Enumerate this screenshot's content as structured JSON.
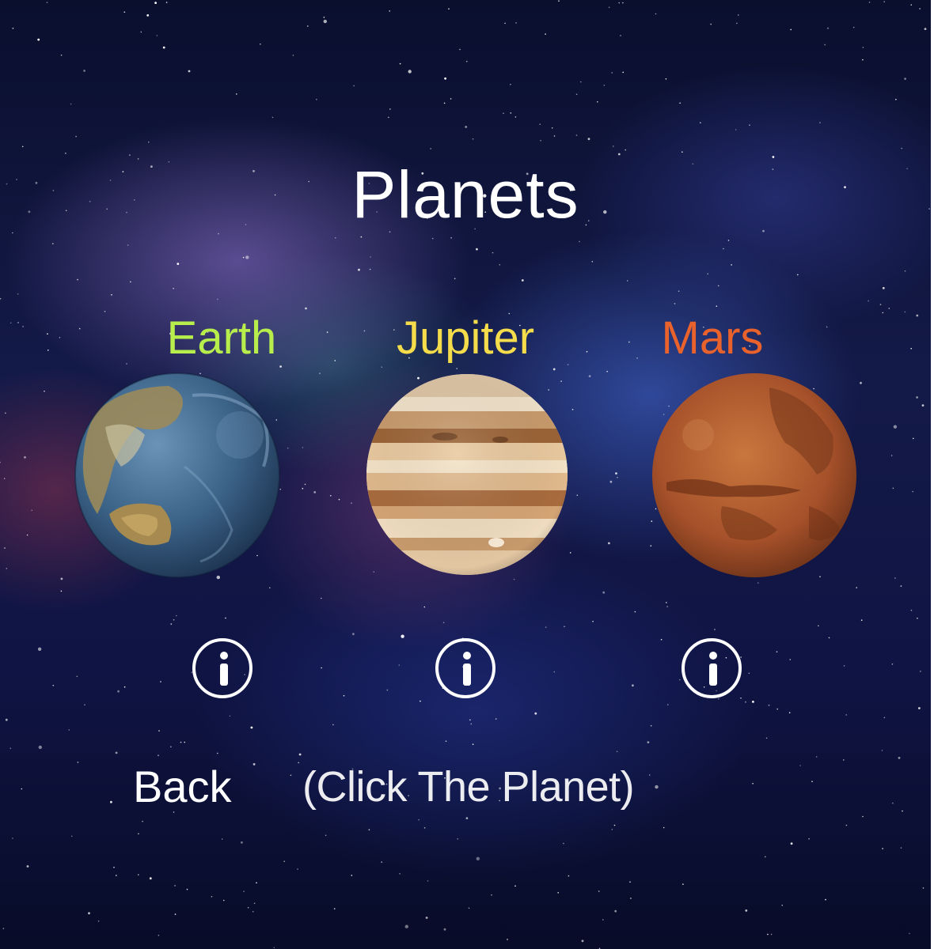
{
  "page": {
    "title": "Planets",
    "hint": "(Click The Planet)",
    "back_label": "Back"
  },
  "planets": [
    {
      "name": "Earth",
      "color": "#b8ee4c",
      "image": "earth-image",
      "info_icon": "info-icon"
    },
    {
      "name": "Jupiter",
      "color": "#f5dc4a",
      "image": "jupiter-image",
      "info_icon": "info-icon"
    },
    {
      "name": "Mars",
      "color": "#e9622c",
      "image": "mars-image",
      "info_icon": "info-icon"
    }
  ],
  "background": "space-nebula-image"
}
